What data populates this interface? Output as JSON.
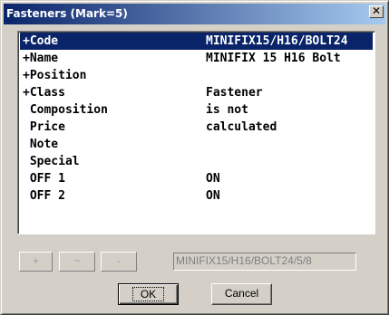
{
  "window": {
    "title": "Fasteners (Mark=5)",
    "close_glyph": "✕"
  },
  "properties": [
    {
      "field": "+Code",
      "value": "MINIFIX15/H16/BOLT24",
      "selected": true
    },
    {
      "field": "+Name",
      "value": "MINIFIX 15 H16 Bolt"
    },
    {
      "field": "+Position",
      "value": ""
    },
    {
      "field": "+Class",
      "value": "Fastener"
    },
    {
      "field": " Composition",
      "value": "is not"
    },
    {
      "field": " Price",
      "value": "calculated"
    },
    {
      "field": " Note",
      "value": ""
    },
    {
      "field": " Special",
      "value": ""
    },
    {
      "field": " OFF 1",
      "value": "ON"
    },
    {
      "field": " OFF 2",
      "value": "ON"
    }
  ],
  "toolbar": {
    "add_label": "+",
    "modify_label": "~",
    "remove_label": "-",
    "path_value": "MINIFIX15/H16/BOLT24/5/8"
  },
  "buttons": {
    "ok_label": "OK",
    "cancel_label": "Cancel"
  },
  "colors": {
    "selection": "#0a246a",
    "title_gradient_start": "#0a246a",
    "title_gradient_end": "#a6caf0",
    "face": "#d4d0c8"
  }
}
